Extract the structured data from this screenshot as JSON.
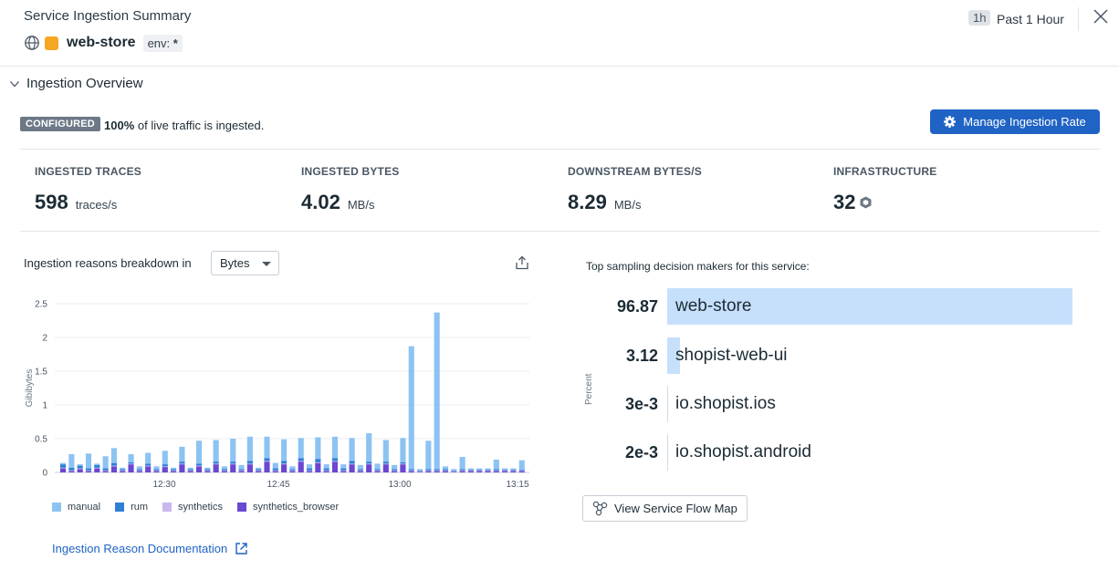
{
  "header": {
    "title": "Service Ingestion Summary",
    "service_name": "web-store",
    "env_key": "env:",
    "env_value": "*",
    "time_badge": "1h",
    "time_label": "Past 1 Hour"
  },
  "section": {
    "title": "Ingestion Overview",
    "configured_badge": "CONFIGURED",
    "live_percent": "100%",
    "live_text": "of live traffic is ingested.",
    "manage_button": "Manage Ingestion Rate"
  },
  "stats": [
    {
      "label": "INGESTED TRACES",
      "value": "598",
      "unit": "traces/s"
    },
    {
      "label": "INGESTED BYTES",
      "value": "4.02",
      "unit": "MB/s"
    },
    {
      "label": "DOWNSTREAM BYTES/S",
      "value": "8.29",
      "unit": "MB/s"
    },
    {
      "label": "INFRASTRUCTURE",
      "value": "32",
      "unit": ""
    }
  ],
  "breakdown": {
    "label": "Ingestion reasons breakdown in",
    "select_value": "Bytes",
    "doc_link": "Ingestion Reason Documentation"
  },
  "colors": {
    "manual": "#8cc3f2",
    "rum": "#2f7fd6",
    "synthetics": "#c9b8f0",
    "synthetics_browser": "#6a48d0",
    "accent": "#1f63c4",
    "service_square": "#f5a623"
  },
  "chart_data": {
    "type": "bar",
    "stacked": true,
    "ylabel": "Gibibytes",
    "ylim": [
      0,
      2.5
    ],
    "yticks": [
      "0",
      "0.5",
      "1",
      "1.5",
      "2",
      "2.5"
    ],
    "xticks": [
      "12:30",
      "12:45",
      "13:00",
      "13:15"
    ],
    "grid": true,
    "legend_position": "bottom",
    "series": [
      {
        "name": "manual",
        "values": [
          0.02,
          0.2,
          0.02,
          0.22,
          0.02,
          0.18,
          0.22,
          0.02,
          0.12,
          0.04,
          0.16,
          0.04,
          0.2,
          0.02,
          0.22,
          0.02,
          0.34,
          0.02,
          0.32,
          0.04,
          0.34,
          0.06,
          0.36,
          0.02,
          0.32,
          0.08,
          0.32,
          0.04,
          0.3,
          0.06,
          0.32,
          0.06,
          0.32,
          0.06,
          0.34,
          0.06,
          0.42,
          0.08,
          0.32,
          0.06,
          0.36,
          1.82,
          0.02,
          0.42,
          2.32,
          0.04,
          0.02,
          0.18,
          0.02,
          0.02,
          0.02,
          0.14,
          0.02,
          0.02,
          0.14
        ]
      },
      {
        "name": "rum",
        "values": [
          0.05,
          0.04,
          0.04,
          0.03,
          0.04,
          0.03,
          0.04,
          0.02,
          0.02,
          0.02,
          0.03,
          0.02,
          0.03,
          0.02,
          0.03,
          0.02,
          0.03,
          0.02,
          0.03,
          0.02,
          0.03,
          0.02,
          0.04,
          0.02,
          0.04,
          0.03,
          0.04,
          0.02,
          0.04,
          0.03,
          0.05,
          0.03,
          0.04,
          0.03,
          0.04,
          0.02,
          0.03,
          0.02,
          0.03,
          0.02,
          0.02,
          0.02,
          0.01,
          0.02,
          0.02,
          0.02,
          0.01,
          0.02,
          0.01,
          0.01,
          0.01,
          0.02,
          0.01,
          0.01,
          0.01
        ]
      },
      {
        "name": "synthetics",
        "values": [
          0.01,
          0.01,
          0.01,
          0.01,
          0.01,
          0.01,
          0.01,
          0.01,
          0.01,
          0.01,
          0.01,
          0.01,
          0.01,
          0.01,
          0.01,
          0.01,
          0.01,
          0.01,
          0.01,
          0.01,
          0.01,
          0.01,
          0.01,
          0.01,
          0.01,
          0.01,
          0.01,
          0.01,
          0.01,
          0.01,
          0.01,
          0.01,
          0.01,
          0.01,
          0.01,
          0.01,
          0.01,
          0.01,
          0.01,
          0.01,
          0.01,
          0.01,
          0.01,
          0.01,
          0.01,
          0.01,
          0.01,
          0.01,
          0.01,
          0.01,
          0.01,
          0.01,
          0.01,
          0.01,
          0.01
        ]
      },
      {
        "name": "synthetics_browser",
        "values": [
          0.06,
          0.02,
          0.05,
          0.02,
          0.06,
          0.02,
          0.09,
          0.02,
          0.12,
          0.02,
          0.09,
          0.02,
          0.08,
          0.02,
          0.12,
          0.02,
          0.09,
          0.02,
          0.12,
          0.02,
          0.12,
          0.02,
          0.12,
          0.02,
          0.16,
          0.02,
          0.12,
          0.02,
          0.16,
          0.02,
          0.14,
          0.02,
          0.16,
          0.02,
          0.12,
          0.02,
          0.12,
          0.02,
          0.12,
          0.02,
          0.12,
          0.02,
          0.01,
          0.02,
          0.02,
          0.02,
          0.01,
          0.02,
          0.02,
          0.02,
          0.02,
          0.02,
          0.02,
          0.02,
          0.02
        ]
      }
    ]
  },
  "decision_makers": {
    "label": "Top sampling decision makers for this service:",
    "axis_label": "Percent",
    "items": [
      {
        "value": "96.87",
        "name": "web-store",
        "pct": 96.87
      },
      {
        "value": "3.12",
        "name": "shopist-web-ui",
        "pct": 3.12
      },
      {
        "value": "3e-3",
        "name": "io.shopist.ios",
        "pct": 0.003
      },
      {
        "value": "2e-3",
        "name": "io.shopist.android",
        "pct": 0.002
      }
    ],
    "flow_button": "View Service Flow Map"
  }
}
